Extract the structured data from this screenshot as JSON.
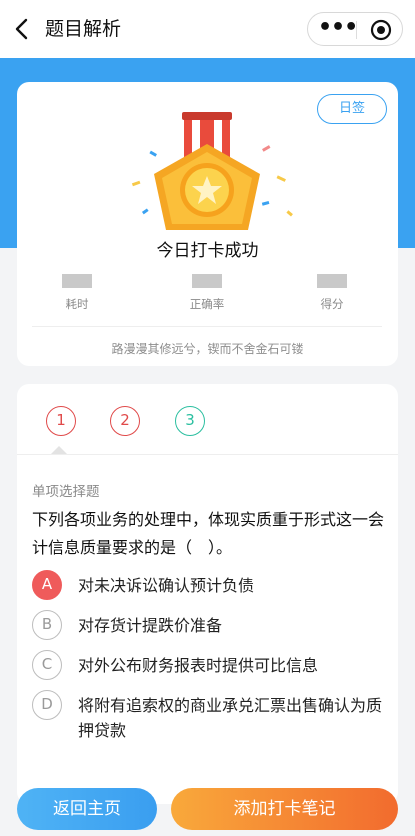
{
  "nav": {
    "title": "题目解析",
    "more_glyph": "•••"
  },
  "result": {
    "signin_label": "日签",
    "title": "今日打卡成功",
    "stats": [
      {
        "label": "耗时"
      },
      {
        "label": "正确率"
      },
      {
        "label": "得分"
      }
    ],
    "quote": "路漫漫其修远兮，锲而不舍金石可镂"
  },
  "question": {
    "tabs": [
      {
        "label": "1",
        "status": "wrong"
      },
      {
        "label": "2",
        "status": "wrong"
      },
      {
        "label": "3",
        "status": "right"
      }
    ],
    "type": "单项选择题",
    "stem": "下列各项业务的处理中，体现实质重于形式这一会计信息质量要求的是（　）。",
    "options": [
      {
        "letter": "A",
        "text": "对未决诉讼确认预计负债",
        "selected": true
      },
      {
        "letter": "B",
        "text": "对存货计提跌价准备",
        "selected": false
      },
      {
        "letter": "C",
        "text": "对外公布财务报表时提供可比信息",
        "selected": false
      },
      {
        "letter": "D",
        "text": "将附有追索权的商业承兑汇票出售确认为质押贷款",
        "selected": false
      }
    ]
  },
  "bottom": {
    "home_label": "返回主页",
    "note_label": "添加打卡笔记"
  },
  "colors": {
    "brand_blue": "#3aa2f1",
    "wrong_red": "#e04a4a",
    "right_green": "#2bbfa0",
    "orange": "#f26b2e"
  },
  "icons": {
    "back": "chevron-left-icon",
    "more": "more-icon",
    "close": "target-icon",
    "medal": "medal-icon"
  }
}
